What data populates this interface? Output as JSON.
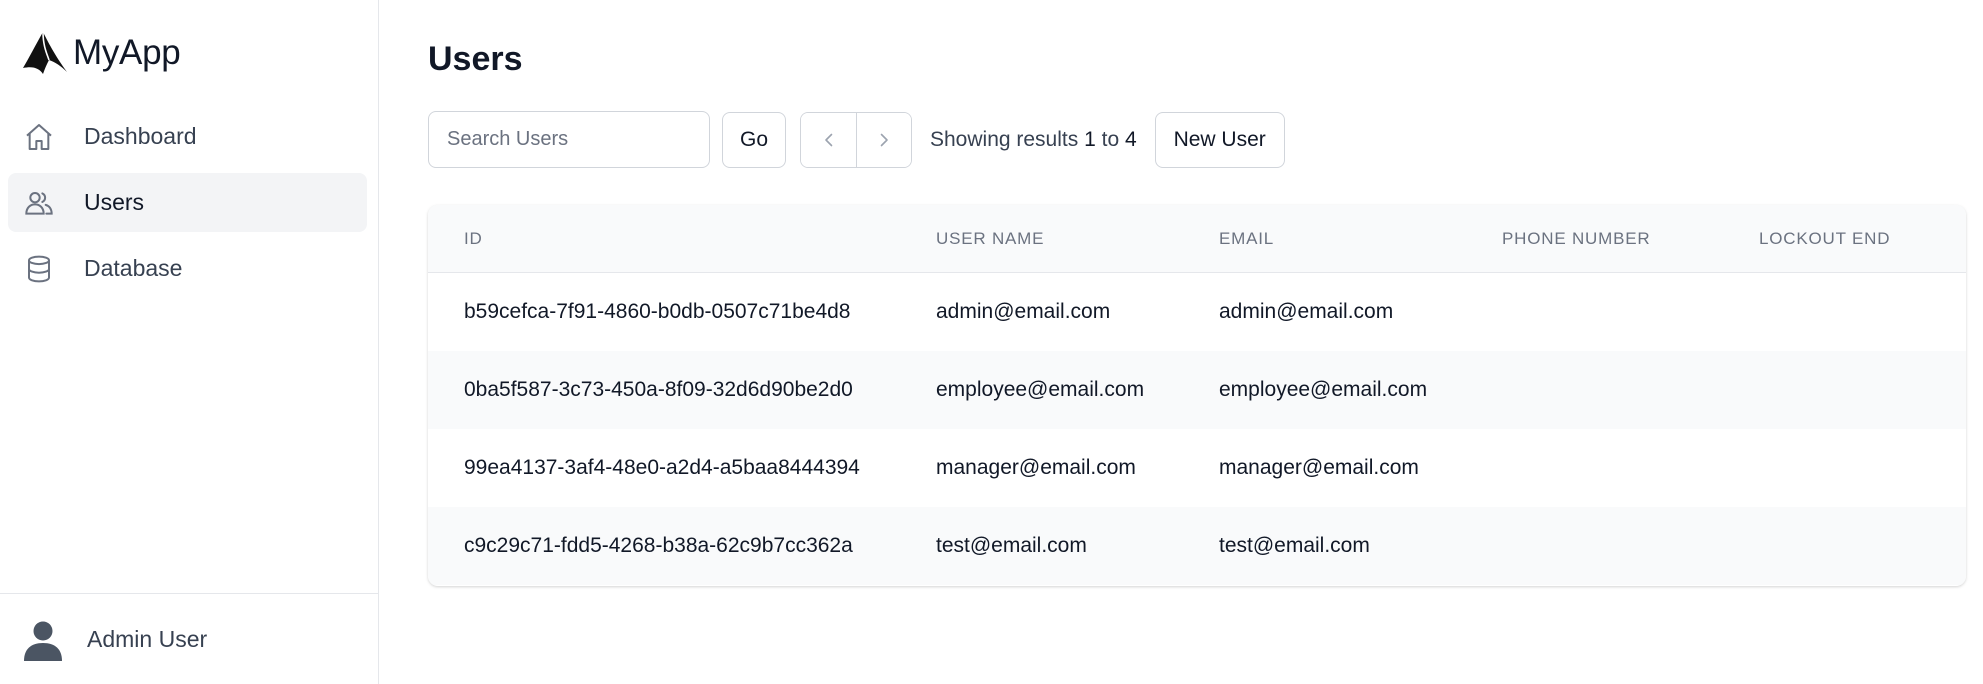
{
  "app": {
    "name": "MyApp"
  },
  "sidebar": {
    "items": [
      {
        "label": "Dashboard",
        "icon": "home-icon",
        "active": false
      },
      {
        "label": "Users",
        "icon": "users-icon",
        "active": true
      },
      {
        "label": "Database",
        "icon": "database-icon",
        "active": false
      }
    ],
    "footer": {
      "name": "Admin User",
      "icon": "user-avatar-icon"
    }
  },
  "main": {
    "title": "Users",
    "toolbar": {
      "search_placeholder": "Search Users",
      "search_value": "",
      "go_label": "Go",
      "prev_icon": "chevron-left-icon",
      "next_icon": "chevron-right-icon",
      "results_prefix": "Showing results",
      "results_from": "1",
      "results_sep": "to",
      "results_to": "4",
      "new_user_label": "New User"
    },
    "table": {
      "columns": [
        "ID",
        "USER NAME",
        "EMAIL",
        "PHONE NUMBER",
        "LOCKOUT END"
      ],
      "rows": [
        {
          "id": "b59cefca-7f91-4860-b0db-0507c71be4d8",
          "user_name": "admin@email.com",
          "email": "admin@email.com",
          "phone": "",
          "lockout_end": ""
        },
        {
          "id": "0ba5f587-3c73-450a-8f09-32d6d90be2d0",
          "user_name": "employee@email.com",
          "email": "employee@email.com",
          "phone": "",
          "lockout_end": ""
        },
        {
          "id": "99ea4137-3af4-48e0-a2d4-a5baa8444394",
          "user_name": "manager@email.com",
          "email": "manager@email.com",
          "phone": "",
          "lockout_end": ""
        },
        {
          "id": "c9c29c71-fdd5-4268-b38a-62c9b7cc362a",
          "user_name": "test@email.com",
          "email": "test@email.com",
          "phone": "",
          "lockout_end": ""
        }
      ]
    }
  },
  "colors": {
    "sidebar_active_bg": "#f3f4f6",
    "border": "#d1d5db",
    "text": "#111827",
    "muted": "#6b7280"
  }
}
